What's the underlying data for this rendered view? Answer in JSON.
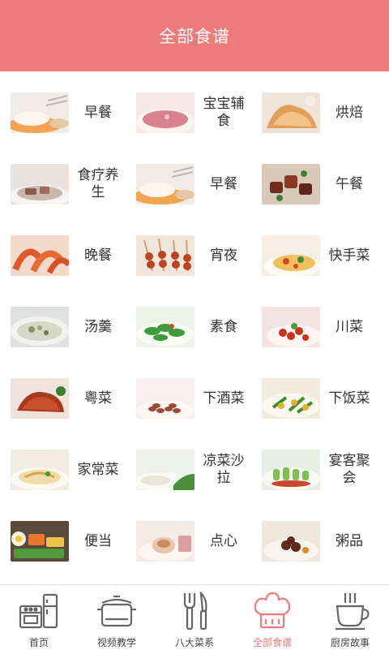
{
  "header": {
    "title": "全部食谱"
  },
  "colors": {
    "brand": "#f07b7b",
    "text": "#333333",
    "tab_inactive": "#555555"
  },
  "categories": [
    {
      "label": "早餐",
      "image": "breakfast-photo"
    },
    {
      "label": "宝宝辅食",
      "image": "baby-food-photo"
    },
    {
      "label": "烘焙",
      "image": "baking-photo"
    },
    {
      "label": "食疗养生",
      "image": "health-soup-photo"
    },
    {
      "label": "早餐",
      "image": "breakfast-photo"
    },
    {
      "label": "午餐",
      "image": "lunch-photo"
    },
    {
      "label": "晚餐",
      "image": "dinner-shrimp-photo"
    },
    {
      "label": "宵夜",
      "image": "skewers-photo"
    },
    {
      "label": "快手菜",
      "image": "quick-dish-photo"
    },
    {
      "label": "汤羹",
      "image": "soup-photo"
    },
    {
      "label": "素食",
      "image": "vegetable-photo"
    },
    {
      "label": "川菜",
      "image": "sichuan-dish-photo"
    },
    {
      "label": "粤菜",
      "image": "roast-duck-photo"
    },
    {
      "label": "下酒菜",
      "image": "peanuts-photo"
    },
    {
      "label": "下饭菜",
      "image": "stir-fry-photo"
    },
    {
      "label": "家常菜",
      "image": "home-dish-photo"
    },
    {
      "label": "凉菜沙拉",
      "image": "cold-dish-photo"
    },
    {
      "label": "宴客聚会",
      "image": "banquet-photo"
    },
    {
      "label": "便当",
      "image": "bento-photo"
    },
    {
      "label": "点心",
      "image": "dim-sum-photo"
    },
    {
      "label": "粥品",
      "image": "congee-photo"
    }
  ],
  "tabs": [
    {
      "label": "首页",
      "icon": "kitchen-icon",
      "active": false
    },
    {
      "label": "视频教学",
      "icon": "pot-icon",
      "active": false
    },
    {
      "label": "八大菜系",
      "icon": "fork-knife-icon",
      "active": false
    },
    {
      "label": "全部食谱",
      "icon": "chef-hat-icon",
      "active": true
    },
    {
      "label": "厨房故事",
      "icon": "coffee-cup-icon",
      "active": false
    }
  ]
}
